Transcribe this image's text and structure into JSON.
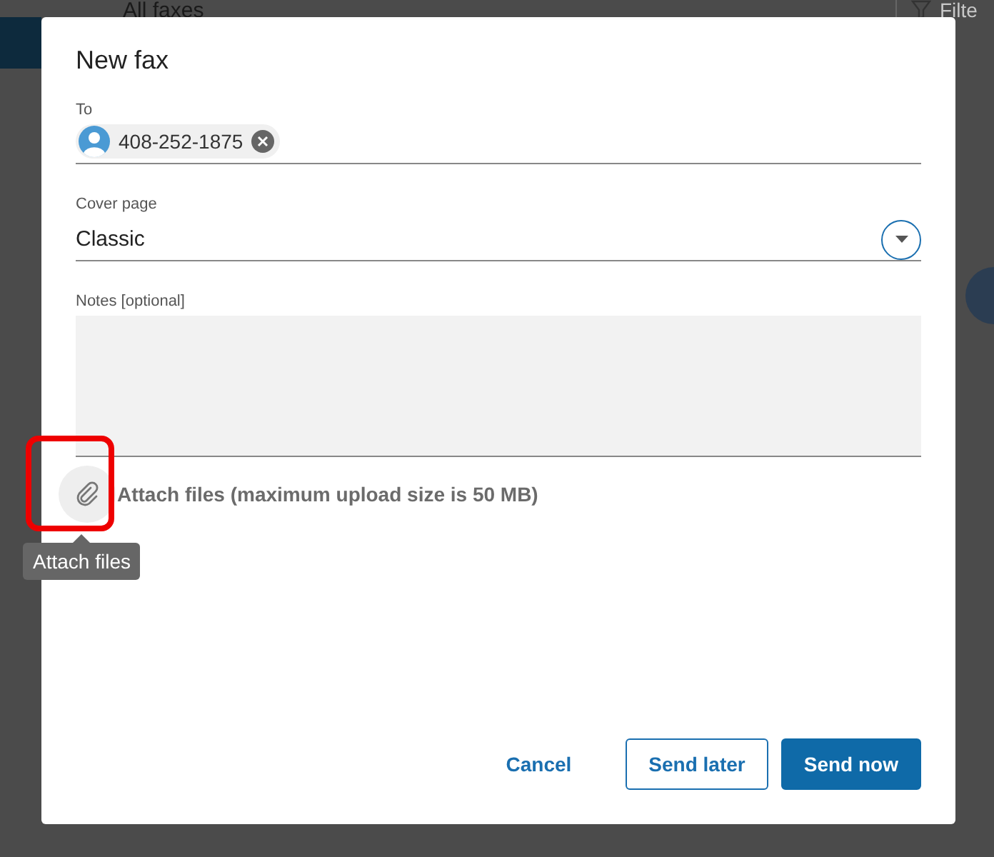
{
  "background": {
    "page_title": "All faxes",
    "filter_label": "Filte"
  },
  "dialog": {
    "title": "New fax",
    "to": {
      "label": "To",
      "recipients": [
        {
          "number": "408-252-1875"
        }
      ]
    },
    "cover_page": {
      "label": "Cover page",
      "value": "Classic"
    },
    "notes": {
      "label": "Notes [optional]"
    },
    "attach": {
      "label": "Attach files (maximum upload size is 50 MB)",
      "tooltip": "Attach files",
      "highlighted": true
    },
    "buttons": [
      {
        "label": "Cancel",
        "kind": "link"
      },
      {
        "label": "Send later",
        "kind": "outline"
      },
      {
        "label": "Send now",
        "kind": "primary"
      }
    ]
  }
}
